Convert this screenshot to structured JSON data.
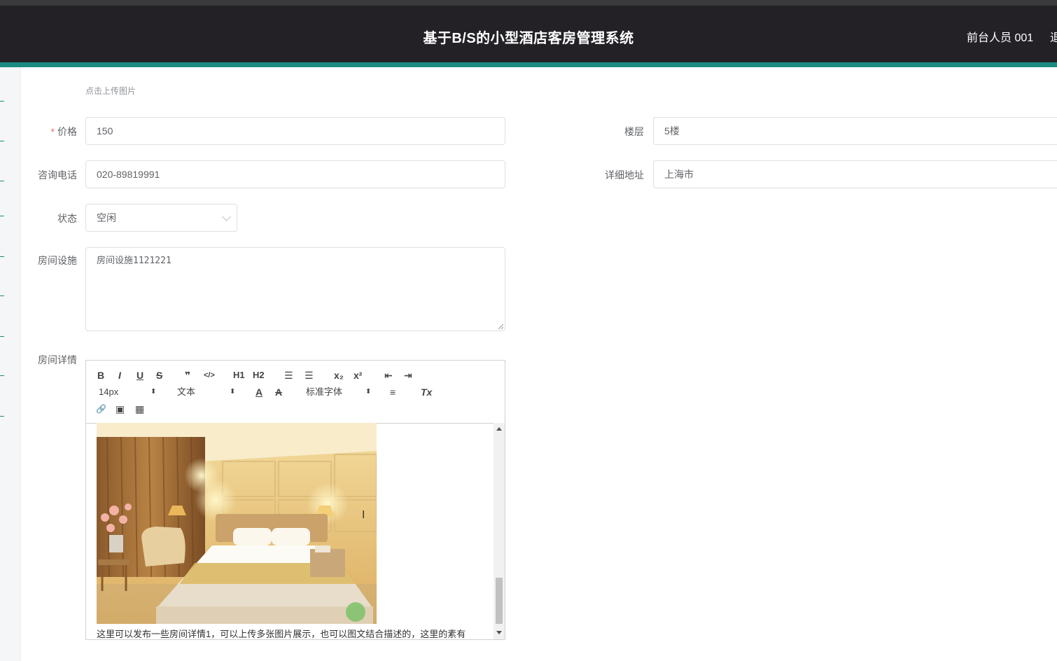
{
  "header": {
    "title": "基于B/S的小型酒店客房管理系统",
    "user": "前台人员 001",
    "logout": "退"
  },
  "upload": {
    "hint": "点击上传图片"
  },
  "form": {
    "price": {
      "label": "价格",
      "required_mark": "*",
      "value": "150"
    },
    "floor": {
      "label": "楼层",
      "value": "5楼"
    },
    "phone": {
      "label": "咨询电话",
      "value": "020-89819991"
    },
    "address": {
      "label": "详细地址",
      "value": "上海市"
    },
    "status": {
      "label": "状态",
      "value": "空闲"
    },
    "facilities": {
      "label": "房间设施",
      "value": "房间设施1121221"
    },
    "details": {
      "label": "房间详情"
    }
  },
  "editor": {
    "toolbar": {
      "bold": "B",
      "italic": "I",
      "underline": "U",
      "strike": "S",
      "quote": "❞",
      "code": "</>",
      "h1": "H1",
      "h2": "H2",
      "ordered_list": "☰",
      "bullet_list": "☰",
      "subscript": "x₂",
      "superscript": "x²",
      "outdent": "⇤",
      "indent": "⇥",
      "size": "14px",
      "header": "文本",
      "font_color": "A",
      "background": "A",
      "font": "标准字体",
      "align": "≡",
      "clean": "Tx",
      "link": "🔗",
      "image": "▣",
      "video": "▦"
    },
    "content_text": "这里可以发布一些房间详情1，可以上传多张图片展示，也可以图文结合描述的，这里的素有"
  },
  "colors": {
    "header_bg": "#232126",
    "accent": "#1b8b80",
    "required": "#f56c6c"
  }
}
